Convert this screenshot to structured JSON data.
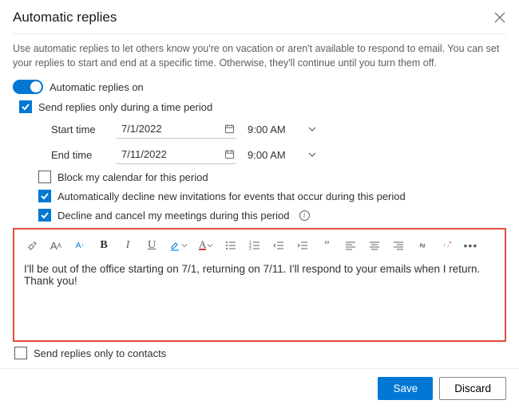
{
  "title": "Automatic replies",
  "description": "Use automatic replies to let others know you're on vacation or aren't available to respond to email. You can set your replies to start and end at a specific time. Otherwise, they'll continue until you turn them off.",
  "toggle_label": "Automatic replies on",
  "time_period_label": "Send replies only during a time period",
  "start": {
    "label": "Start time",
    "date": "7/1/2022",
    "time": "9:00 AM"
  },
  "end": {
    "label": "End time",
    "date": "7/11/2022",
    "time": "9:00 AM"
  },
  "options": {
    "block": "Block my calendar for this period",
    "decline_new": "Automatically decline new invitations for events that occur during this period",
    "cancel": "Decline and cancel my meetings during this period"
  },
  "message": "I'll be out of the office starting on 7/1, returning on 7/11. I'll respond to your emails when I return. Thank you!",
  "contacts_only": "Send replies only to contacts",
  "buttons": {
    "save": "Save",
    "discard": "Discard"
  }
}
